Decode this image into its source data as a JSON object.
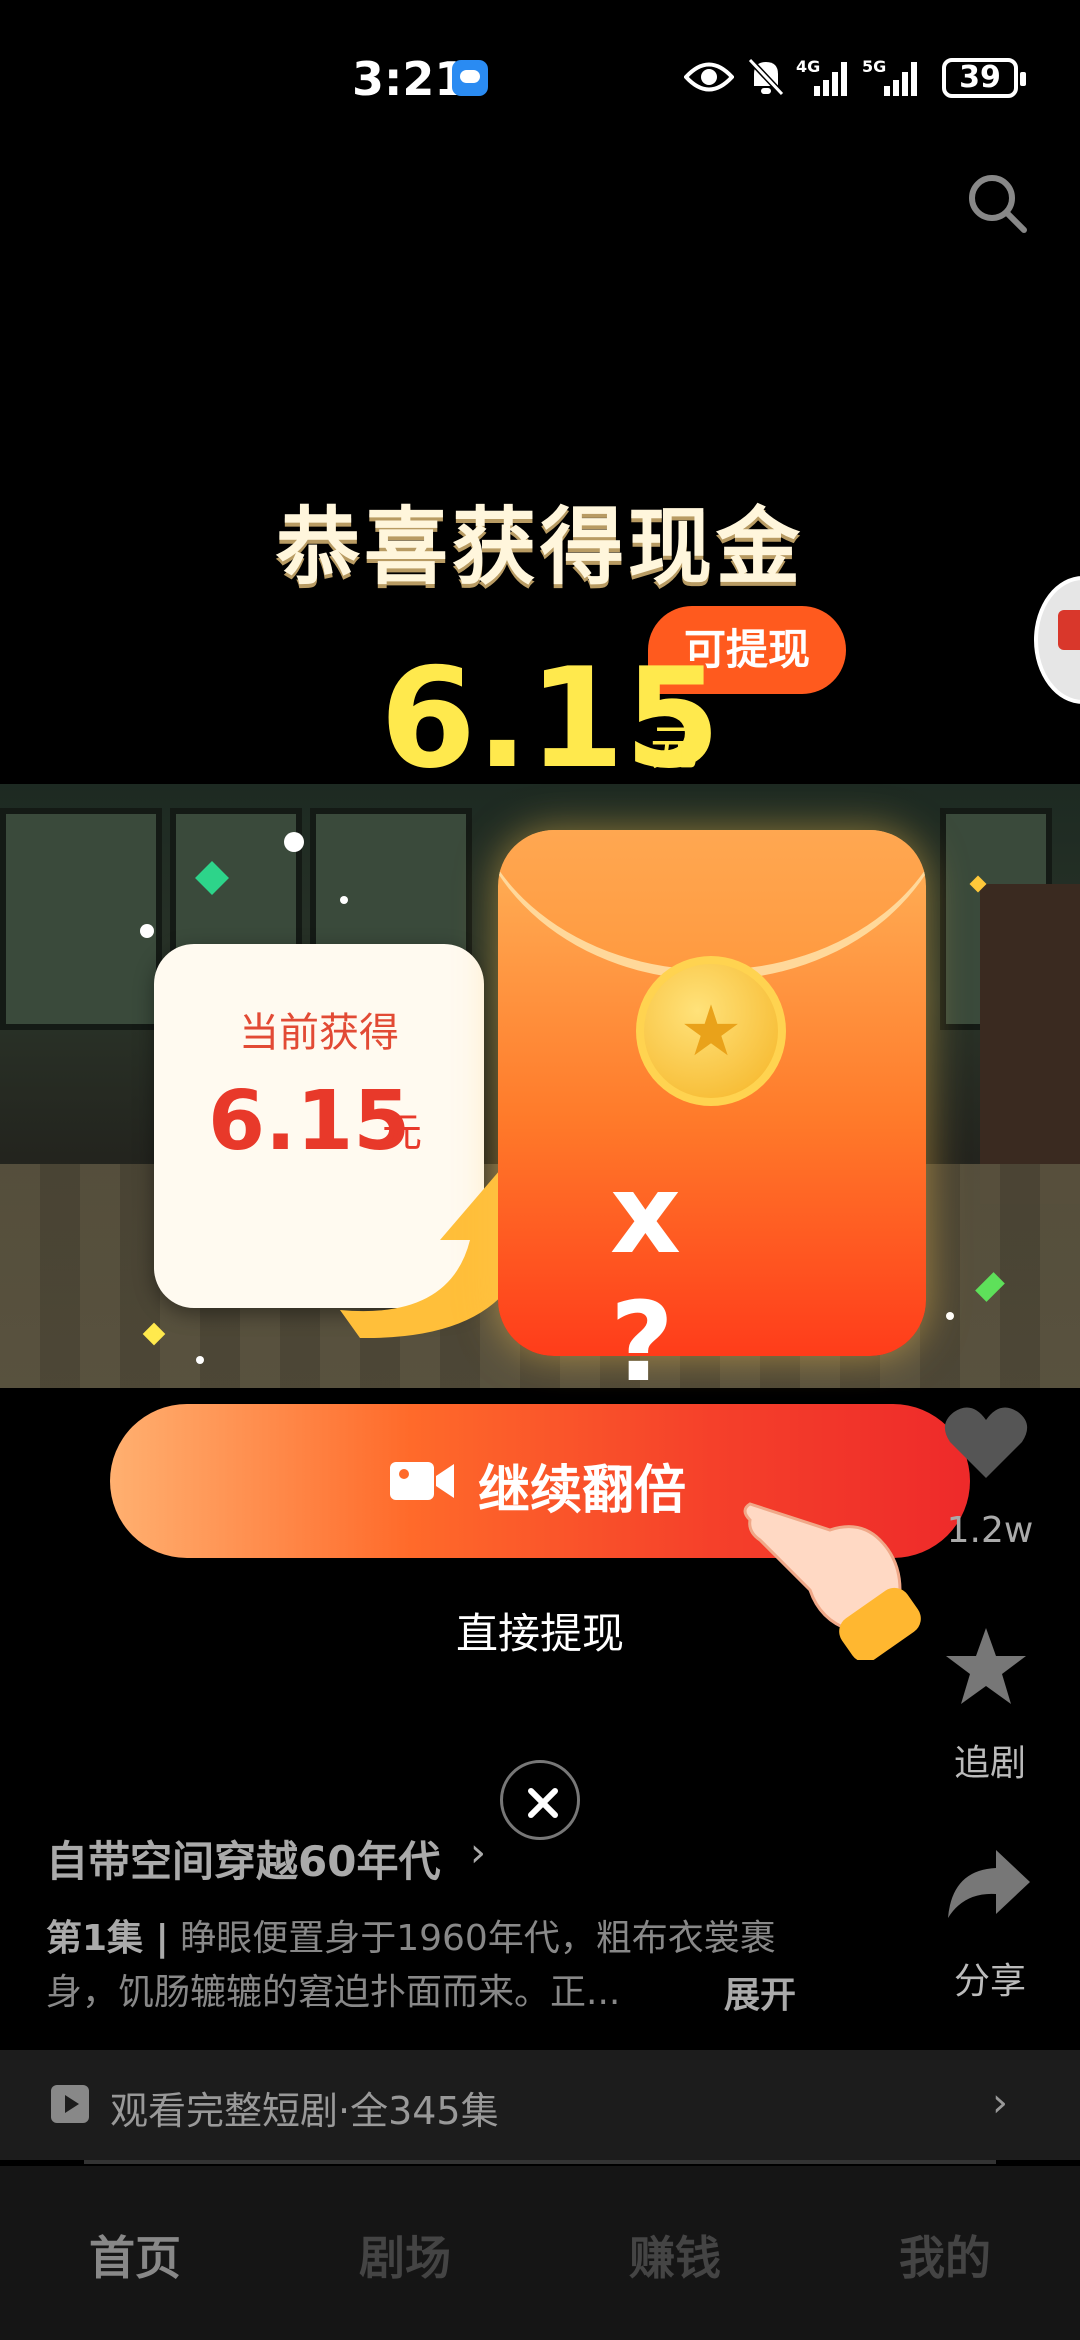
{
  "status_bar": {
    "time": "3:21",
    "network_1": "4G",
    "network_2": "5G",
    "battery": "39"
  },
  "popup": {
    "title": "恭喜获得现金",
    "amount": "6.15",
    "unit": "元",
    "badge": "可提现",
    "card_label": "当前获得",
    "card_amount": "6.15",
    "card_unit": "元",
    "envelope_text": "x ?",
    "primary_button": "继续翻倍",
    "secondary_button": "直接提现"
  },
  "side_actions": {
    "like_count": "1.2w",
    "follow_label": "追剧",
    "share_label": "分享"
  },
  "drama": {
    "title": "自带空间穿越60年代",
    "episode": "第1集 |",
    "description": "睁眼便置身于1960年代，粗布衣裳裹身，饥肠辘辘的窘迫扑面而来。正...",
    "expand": "展开",
    "watch_full": "观看完整短剧·全345集"
  },
  "tabs": [
    "首页",
    "剧场",
    "赚钱",
    "我的"
  ],
  "colors": {
    "accent_orange": "#ff5a1e",
    "amount_yellow": "#ffe94d",
    "card_red": "#e8392a"
  },
  "icons": [
    "search-icon",
    "eye-icon",
    "bell-off-icon",
    "signal-icon",
    "battery-icon",
    "video-camera-icon",
    "heart-icon",
    "star-icon",
    "share-icon",
    "close-icon",
    "play-icon"
  ]
}
